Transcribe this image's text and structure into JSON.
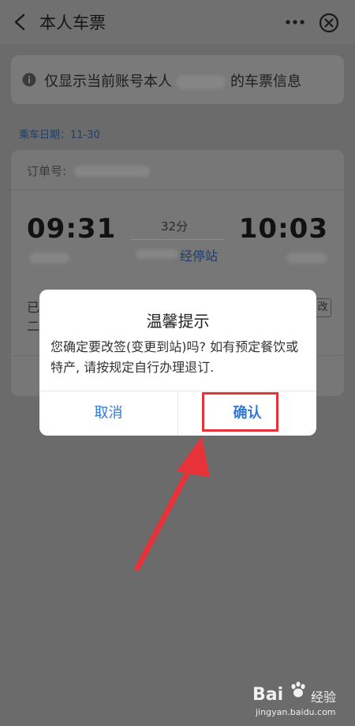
{
  "header": {
    "title": "本人车票",
    "icons": {
      "back": "back-arrow-icon",
      "more": "more-dots-icon",
      "close": "close-circle-icon"
    }
  },
  "notice": {
    "text_prefix": "仅显示当前账号本人",
    "text_suffix": "的车票信息"
  },
  "ride_date": "乘车日期：11-30",
  "ticket": {
    "order_label": "订单号:",
    "departure_time": "09:31",
    "arrival_time": "10:03",
    "duration": "32分",
    "stops_link": "经停站",
    "peek_line1": "已",
    "peek_line2": "二",
    "peek_badge": "改"
  },
  "dialog": {
    "title": "温馨提示",
    "message": "您确定要改签(变更到站)吗? 如有预定餐饮或特产, 请按规定自行办理退订.",
    "cancel_label": "取消",
    "confirm_label": "确认",
    "highlight_color": "#e8323a"
  },
  "watermark": {
    "brand": "Bai",
    "product": "经验",
    "url": "jingyan.baidu.com"
  },
  "colors": {
    "accent": "#2f78d6",
    "annotation": "#e8323a",
    "overlay_bg": "#6b6b6b"
  }
}
